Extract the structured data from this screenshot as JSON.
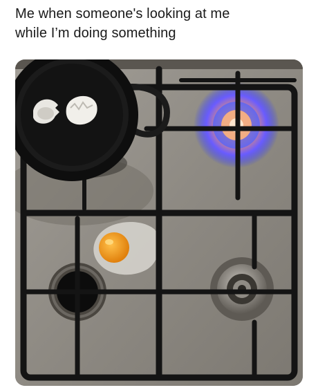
{
  "meme": {
    "caption_lines": [
      "Me when someone's looking at me",
      "while I’m doing something"
    ]
  },
  "photo": {
    "subject_icons": [
      "frying-pan-icon",
      "eggshell-icon",
      "gas-flame-icon",
      "cracked-egg-icon",
      "burner-icon"
    ],
    "colors": {
      "stove_top": "#9a958d",
      "grate": "#151515",
      "pan": "#111111",
      "flame_blue": "#3b55ff",
      "flame_orange": "#ff8a3a",
      "yolk": "#f29a16"
    }
  }
}
